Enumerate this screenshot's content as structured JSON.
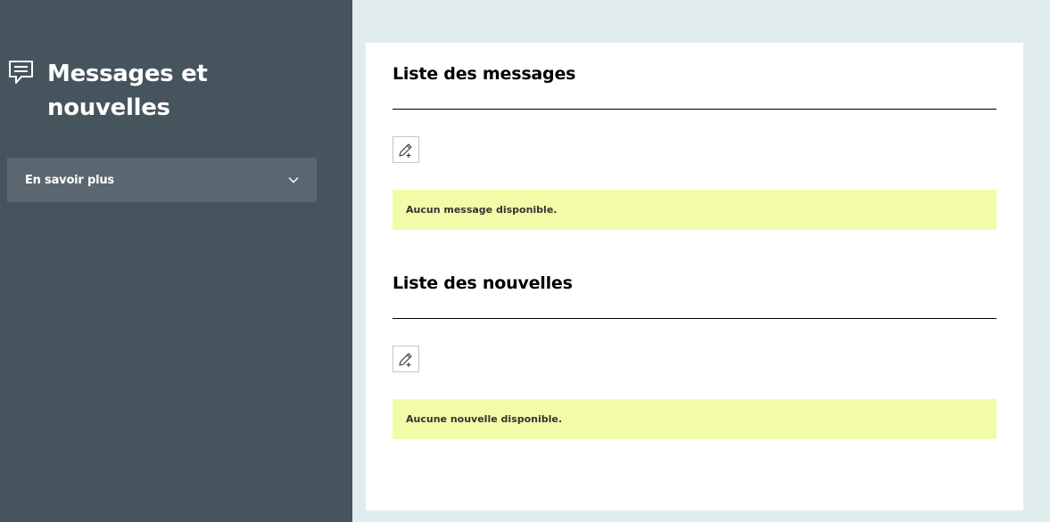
{
  "sidebar": {
    "title": "Messages et nouvelles",
    "header_icon": "chat-bubble-icon",
    "accordion_label": "En savoir plus",
    "accordion_icon": "chevron-down-icon"
  },
  "messages": {
    "title": "Liste des messages",
    "add_icon": "pencil-add-icon",
    "empty_text": "Aucun message disponible."
  },
  "news": {
    "title": "Liste des nouvelles",
    "add_icon": "pencil-add-icon",
    "empty_text": "Aucune nouvelle disponible."
  },
  "colors": {
    "sidebar_bg": "#46545d",
    "accordion_bg": "#5b6770",
    "page_bg": "#e1ecef",
    "notice_bg": "#f2fba8"
  }
}
